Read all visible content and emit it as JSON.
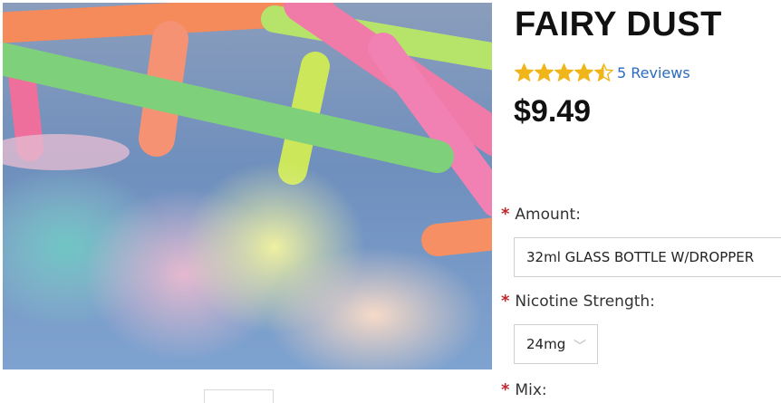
{
  "product": {
    "title": "FAIRY DUST",
    "rating_value": 4.5,
    "rating_max": 5,
    "reviews_label": "5 Reviews",
    "price": "$9.49"
  },
  "colors": {
    "star": "#f0b518",
    "link": "#2a6bbd",
    "required": "#c0272d"
  },
  "options": {
    "required_mark": "*",
    "amount": {
      "label": "Amount:",
      "selected": "32ml GLASS BOTTLE W/DROPPER"
    },
    "nicotine": {
      "label": "Nicotine Strength:",
      "selected": "24mg"
    },
    "mix": {
      "label": "Mix:"
    }
  },
  "icons": {
    "star": "star-icon",
    "half_star": "star-half-icon",
    "select_arrow": "chevron-down-icon"
  }
}
